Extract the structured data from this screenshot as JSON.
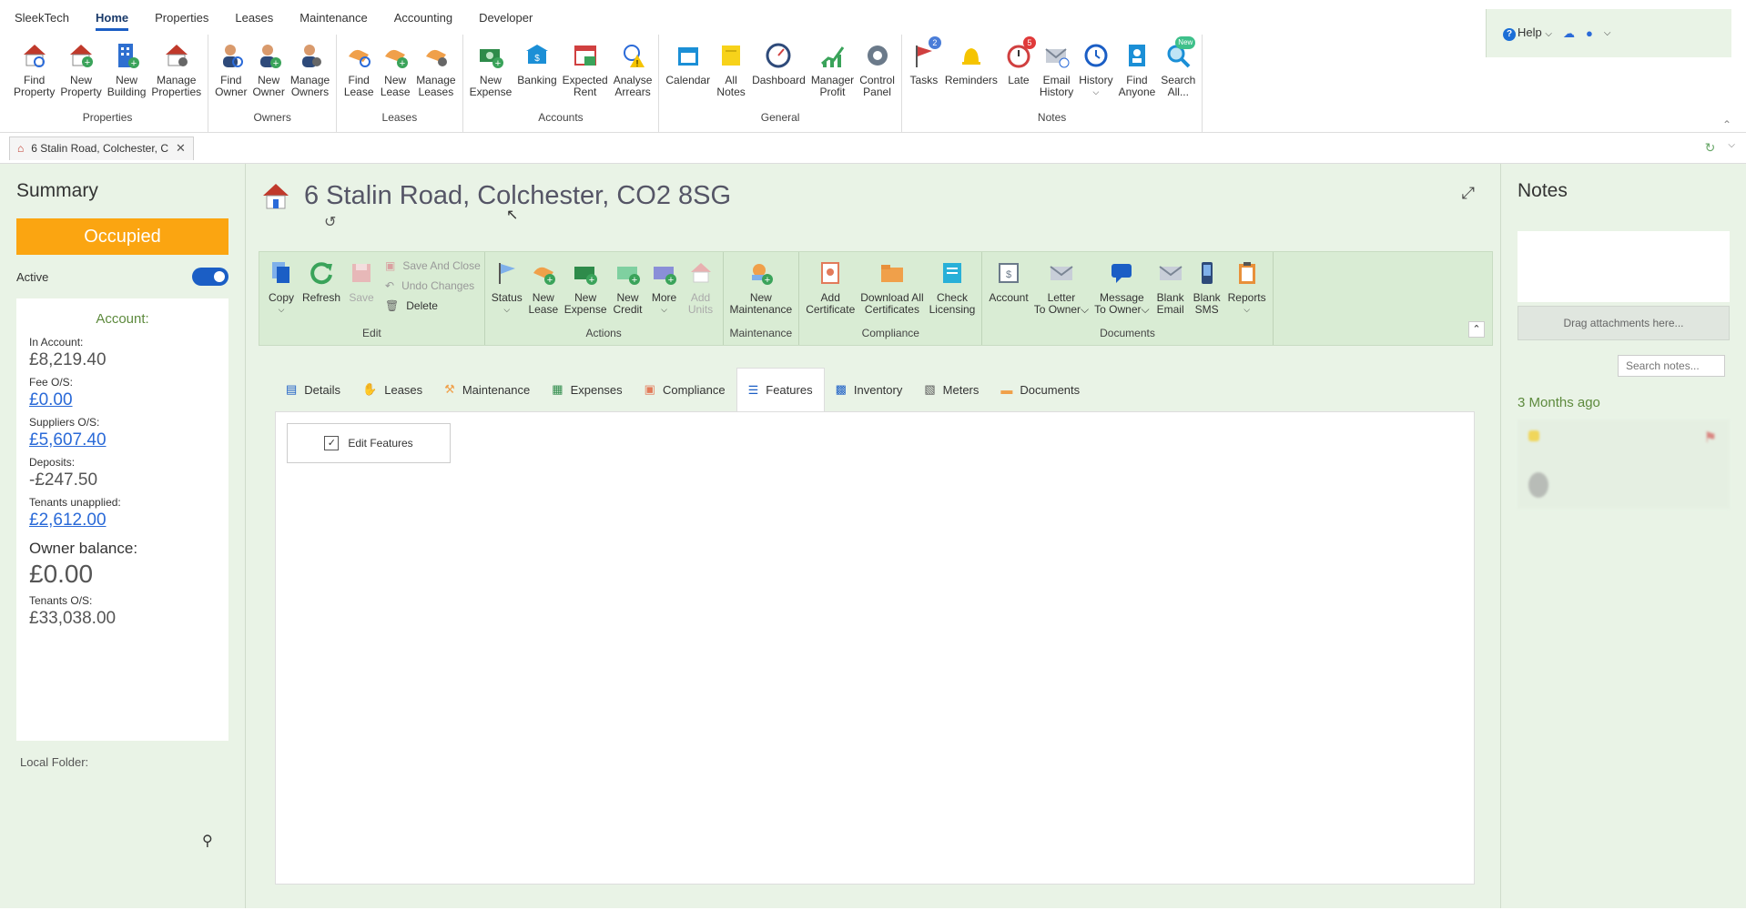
{
  "menu": {
    "items": [
      "SleekTech",
      "Home",
      "Properties",
      "Leases",
      "Maintenance",
      "Accounting",
      "Developer"
    ],
    "active": "Home",
    "help_label": "Help"
  },
  "ribbon": {
    "groups": [
      {
        "label": "Properties",
        "buttons": [
          {
            "l1": "Find",
            "l2": "Property",
            "icon": "find-property-icon"
          },
          {
            "l1": "New",
            "l2": "Property",
            "icon": "new-property-icon"
          },
          {
            "l1": "New",
            "l2": "Building",
            "icon": "new-building-icon"
          },
          {
            "l1": "Manage",
            "l2": "Properties",
            "icon": "manage-properties-icon"
          }
        ]
      },
      {
        "label": "Owners",
        "buttons": [
          {
            "l1": "Find",
            "l2": "Owner",
            "icon": "find-owner-icon"
          },
          {
            "l1": "New",
            "l2": "Owner",
            "icon": "new-owner-icon"
          },
          {
            "l1": "Manage",
            "l2": "Owners",
            "icon": "manage-owners-icon"
          }
        ]
      },
      {
        "label": "Leases",
        "buttons": [
          {
            "l1": "Find",
            "l2": "Lease",
            "icon": "find-lease-icon"
          },
          {
            "l1": "New",
            "l2": "Lease",
            "icon": "new-lease-icon"
          },
          {
            "l1": "Manage",
            "l2": "Leases",
            "icon": "manage-leases-icon"
          }
        ]
      },
      {
        "label": "Accounts",
        "buttons": [
          {
            "l1": "New",
            "l2": "Expense",
            "icon": "new-expense-icon"
          },
          {
            "l1": "Banking",
            "l2": "",
            "icon": "banking-icon"
          },
          {
            "l1": "Expected",
            "l2": "Rent",
            "icon": "expected-rent-icon"
          },
          {
            "l1": "Analyse",
            "l2": "Arrears",
            "icon": "analyse-arrears-icon"
          }
        ]
      },
      {
        "label": "General",
        "buttons": [
          {
            "l1": "Calendar",
            "l2": "",
            "icon": "calendar-icon"
          },
          {
            "l1": "All",
            "l2": "Notes",
            "icon": "all-notes-icon"
          },
          {
            "l1": "Dashboard",
            "l2": "",
            "icon": "dashboard-icon"
          },
          {
            "l1": "Manager",
            "l2": "Profit",
            "icon": "manager-profit-icon"
          },
          {
            "l1": "Control",
            "l2": "Panel",
            "icon": "control-panel-icon"
          }
        ]
      },
      {
        "label": "Notes",
        "buttons": [
          {
            "l1": "Tasks",
            "l2": "",
            "icon": "tasks-icon",
            "badge": "2"
          },
          {
            "l1": "Reminders",
            "l2": "",
            "icon": "reminders-icon"
          },
          {
            "l1": "Late",
            "l2": "",
            "icon": "late-icon",
            "badge": "5"
          },
          {
            "l1": "Email",
            "l2": "History",
            "icon": "email-history-icon"
          },
          {
            "l1": "History",
            "l2": "",
            "icon": "history-icon"
          },
          {
            "l1": "Find",
            "l2": "Anyone",
            "icon": "find-anyone-icon"
          },
          {
            "l1": "Search",
            "l2": "All...",
            "icon": "search-all-icon",
            "badge": "New"
          }
        ]
      }
    ]
  },
  "doc_tab": {
    "title": "6 Stalin Road, Colchester, C"
  },
  "summary": {
    "heading": "Summary",
    "status": "Occupied",
    "active_label": "Active",
    "account_heading": "Account:",
    "rows": [
      {
        "label": "In Account:",
        "value": "£8,219.40",
        "link": false
      },
      {
        "label": "Fee O/S:",
        "value": "£0.00",
        "link": true
      },
      {
        "label": "Suppliers O/S:",
        "value": "£5,607.40",
        "link": true
      },
      {
        "label": "Deposits:",
        "value": "-£247.50",
        "link": false
      },
      {
        "label": "Tenants unapplied:",
        "value": "£2,612.00",
        "link": true
      }
    ],
    "owner_balance_label": "Owner balance:",
    "owner_balance": "£0.00",
    "tenants_os_label": "Tenants O/S:",
    "tenants_os": "£33,038.00",
    "local_folder": "Local Folder:"
  },
  "property": {
    "address": "6 Stalin Road, Colchester, CO2 8SG"
  },
  "inner_ribbon": {
    "edit": {
      "label": "Edit",
      "copy": "Copy",
      "refresh": "Refresh",
      "save": "Save",
      "save_close": "Save And Close",
      "undo": "Undo Changes",
      "delete": "Delete"
    },
    "actions": {
      "label": "Actions",
      "status": "Status",
      "new_lease_1": "New",
      "new_lease_2": "Lease",
      "new_expense_1": "New",
      "new_expense_2": "Expense",
      "new_credit_1": "New",
      "new_credit_2": "Credit",
      "more": "More",
      "add_units_1": "Add",
      "add_units_2": "Units"
    },
    "maintenance": {
      "label": "Maintenance",
      "l1": "New",
      "l2": "Maintenance"
    },
    "compliance": {
      "label": "Compliance",
      "add_cert_1": "Add",
      "add_cert_2": "Certificate",
      "dl_1": "Download All",
      "dl_2": "Certificates",
      "check_1": "Check",
      "check_2": "Licensing"
    },
    "documents": {
      "label": "Documents",
      "account": "Account",
      "letter_1": "Letter",
      "letter_2": "To Owner",
      "message_1": "Message",
      "message_2": "To Owner",
      "blank_email_1": "Blank",
      "blank_email_2": "Email",
      "blank_sms_1": "Blank",
      "blank_sms_2": "SMS",
      "reports": "Reports"
    }
  },
  "tabs": [
    "Details",
    "Leases",
    "Maintenance",
    "Expenses",
    "Compliance",
    "Features",
    "Inventory",
    "Meters",
    "Documents"
  ],
  "active_tab": "Features",
  "features": {
    "edit_button": "Edit Features"
  },
  "notes": {
    "heading": "Notes",
    "drag": "Drag attachments here...",
    "search_placeholder": "Search notes...",
    "group": "3 Months ago"
  },
  "colors": {
    "accent": "#1b5ec5",
    "occupied": "#fba511",
    "panel_bg": "#e9f3e6",
    "ribbon_bg": "#d9ecd4"
  }
}
